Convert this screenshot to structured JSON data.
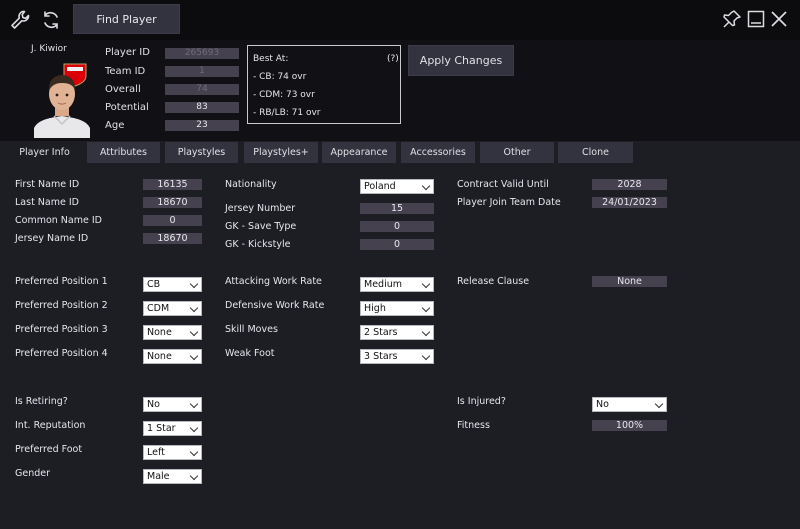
{
  "toolbar": {
    "find_player_label": "Find Player"
  },
  "player": {
    "short_name": "J. Kiwior",
    "fields": [
      {
        "label": "Player ID",
        "value": "265693",
        "bright": false
      },
      {
        "label": "Team ID",
        "value": "1",
        "bright": false
      },
      {
        "label": "Overall",
        "value": "74",
        "bright": false
      },
      {
        "label": "Potential",
        "value": "83",
        "bright": true
      },
      {
        "label": "Age",
        "value": "23",
        "bright": true
      }
    ],
    "best_at": {
      "title": "Best At:",
      "help": "(?)",
      "lines": [
        "- CB: 74 ovr",
        "- CDM: 73 ovr",
        "- RB/LB: 71 ovr"
      ]
    },
    "apply_label": "Apply Changes"
  },
  "tabs": [
    "Player Info",
    "Attributes",
    "Playstyles",
    "Playstyles+",
    "Appearance",
    "Accessories",
    "Other",
    "Clone"
  ],
  "form": {
    "first_name_id": {
      "label": "First Name ID",
      "value": "16135"
    },
    "last_name_id": {
      "label": "Last Name ID",
      "value": "18670"
    },
    "common_name_id": {
      "label": "Common Name ID",
      "value": "0"
    },
    "jersey_name_id": {
      "label": "Jersey Name ID",
      "value": "18670"
    },
    "nationality": {
      "label": "Nationality",
      "value": "Poland"
    },
    "jersey_number": {
      "label": "Jersey Number",
      "value": "15"
    },
    "gk_save_type": {
      "label": "GK - Save Type",
      "value": "0"
    },
    "gk_kickstyle": {
      "label": "GK - Kickstyle",
      "value": "0"
    },
    "contract_valid_until": {
      "label": "Contract Valid Until",
      "value": "2028"
    },
    "join_team_date": {
      "label": "Player Join Team Date",
      "value": "24/01/2023"
    },
    "pref_pos_1": {
      "label": "Preferred Position 1",
      "value": "CB"
    },
    "pref_pos_2": {
      "label": "Preferred Position 2",
      "value": "CDM"
    },
    "pref_pos_3": {
      "label": "Preferred Position 3",
      "value": "None"
    },
    "pref_pos_4": {
      "label": "Preferred Position 4",
      "value": "None"
    },
    "attacking_work_rate": {
      "label": "Attacking Work Rate",
      "value": "Medium"
    },
    "defensive_work_rate": {
      "label": "Defensive Work Rate",
      "value": "High"
    },
    "skill_moves": {
      "label": "Skill Moves",
      "value": "2 Stars"
    },
    "weak_foot": {
      "label": "Weak Foot",
      "value": "3 Stars"
    },
    "release_clause": {
      "label": "Release Clause",
      "value": "None"
    },
    "is_retiring": {
      "label": "Is Retiring?",
      "value": "No"
    },
    "int_reputation": {
      "label": "Int. Reputation",
      "value": "1 Star"
    },
    "preferred_foot": {
      "label": "Preferred Foot",
      "value": "Left"
    },
    "gender": {
      "label": "Gender",
      "value": "Male"
    },
    "is_injured": {
      "label": "Is Injured?",
      "value": "No"
    },
    "fitness": {
      "label": "Fitness",
      "value": "100%"
    }
  },
  "colors": {
    "club_red": "#db0007",
    "accent_panel": "#33323f",
    "value_bg": "#45414f"
  }
}
